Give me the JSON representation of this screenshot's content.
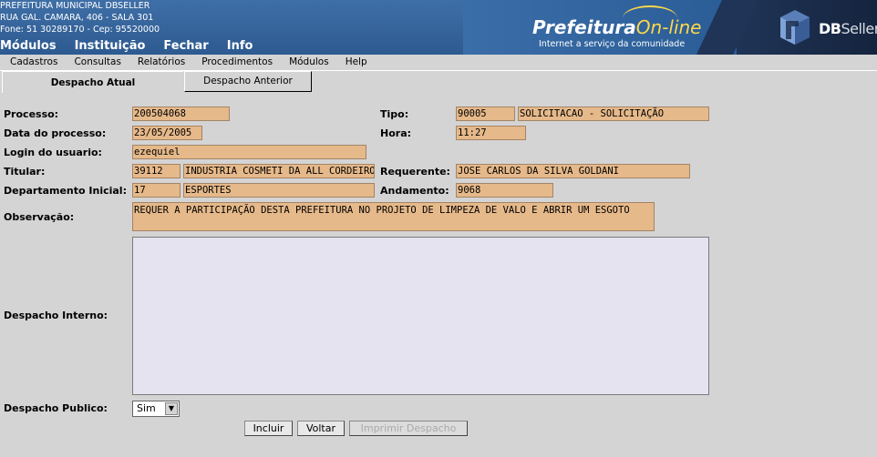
{
  "header": {
    "institution": [
      "PREFEITURA MUNICIPAL DBSELLER",
      "RUA GAL. CAMARA, 406 - SALA 301",
      "Fone: 51 30289170  -  Cep: 95520000"
    ],
    "logo_main": "Prefeitura",
    "logo_online": "On-line",
    "logo_sub": "Internet a serviço da comunidade",
    "db_brand_bold": "DB",
    "db_brand_light": "Seller",
    "menu": [
      "Módulos",
      "Instituição",
      "Fechar",
      "Info"
    ]
  },
  "submenu": [
    "Cadastros",
    "Consultas",
    "Relatórios",
    "Procedimentos",
    "Módulos",
    "Help"
  ],
  "tabs": {
    "active": "Despacho Atual",
    "inactive": "Despacho Anterior"
  },
  "form": {
    "processo_label": "Processo:",
    "processo": "200504068",
    "tipo_label": "Tipo:",
    "tipo_code": "90005",
    "tipo_desc": "SOLICITACAO - SOLICITAÇÃO",
    "data_label": "Data do processo:",
    "data": "23/05/2005",
    "hora_label": "Hora:",
    "hora": "11:27",
    "login_label": "Login do usuario:",
    "login": "ezequiel",
    "titular_label": "Titular:",
    "titular_code": "39112",
    "titular_name": "INDUSTRIA COSMETI DA ALL CORDEIRO",
    "requerente_label": "Requerente:",
    "requerente": "JOSE CARLOS DA SILVA GOLDANI",
    "depto_label": "Departamento Inicial:",
    "depto_code": "17",
    "depto_name": "ESPORTES",
    "andamento_label": "Andamento:",
    "andamento": "9068",
    "obs_label": "Observação:",
    "obs": "REQUER A PARTICIPAÇÃO DESTA PREFEITURA NO PROJETO DE LIMPEZA DE VALO E ABRIR UM ESGOTO",
    "despacho_interno_label": "Despacho Interno:",
    "despacho_interno": "",
    "despacho_publico_label": "Despacho Publico:",
    "despacho_publico": "Sim"
  },
  "buttons": {
    "incluir": "Incluir",
    "voltar": "Voltar",
    "imprimir": "Imprimir Despacho"
  }
}
